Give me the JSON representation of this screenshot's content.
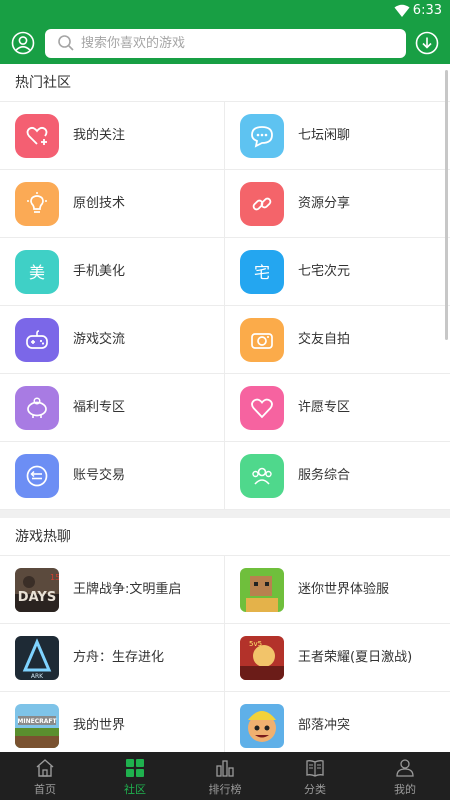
{
  "status_bar": {
    "time": "6:33",
    "wifi_icon": "wifi-icon"
  },
  "top_bar": {
    "avatar_icon": "user-avatar-icon",
    "search": {
      "placeholder": "搜索你喜欢的游戏",
      "value": "",
      "icon": "search-icon"
    },
    "download_icon": "download-icon",
    "background": "#189f44"
  },
  "hot_communities": {
    "title": "热门社区",
    "items": [
      {
        "label": "我的关注",
        "icon": "heart-plus-icon",
        "color": "#f45f72"
      },
      {
        "label": "七坛闲聊",
        "icon": "chat-bubble-icon",
        "color": "#5ec3f1"
      },
      {
        "label": "原创技术",
        "icon": "lightbulb-icon",
        "color": "#fbaa55"
      },
      {
        "label": "资源分享",
        "icon": "link-icon",
        "color": "#f4646a"
      },
      {
        "label": "手机美化",
        "icon": "beautify-icon",
        "color": "#3fd0c6"
      },
      {
        "label": "七宅次元",
        "icon": "house-char-icon",
        "color": "#24a6f0"
      },
      {
        "label": "游戏交流",
        "icon": "gamepad-icon",
        "color": "#7b67e8"
      },
      {
        "label": "交友自拍",
        "icon": "camera-icon",
        "color": "#fbab4a"
      },
      {
        "label": "福利专区",
        "icon": "piggy-bank-icon",
        "color": "#a87be3"
      },
      {
        "label": "许愿专区",
        "icon": "heart-icon",
        "color": "#f663a0"
      },
      {
        "label": "账号交易",
        "icon": "exchange-icon",
        "color": "#6c8ef4"
      },
      {
        "label": "服务综合",
        "icon": "users-icon",
        "color": "#4fd88c"
      }
    ]
  },
  "hot_games": {
    "title": "游戏热聊",
    "items": [
      {
        "label": "王牌战争:文明重启",
        "thumb": "game-thumb-wangpai"
      },
      {
        "label": "迷你世界体验服",
        "thumb": "game-thumb-mini-world"
      },
      {
        "label": "方舟：生存进化",
        "thumb": "game-thumb-ark"
      },
      {
        "label": "王者荣耀(夏日激战)",
        "thumb": "game-thumb-honor-of-kings"
      },
      {
        "label": "我的世界",
        "thumb": "game-thumb-minecraft"
      },
      {
        "label": "部落冲突",
        "thumb": "game-thumb-clash-of-clans"
      }
    ]
  },
  "bottom_nav": {
    "active_color": "#1fb14e",
    "tabs": [
      {
        "label": "首页",
        "icon": "home-icon",
        "active": false
      },
      {
        "label": "社区",
        "icon": "grid-icon",
        "active": true
      },
      {
        "label": "排行榜",
        "icon": "ranking-icon",
        "active": false
      },
      {
        "label": "分类",
        "icon": "book-icon",
        "active": false
      },
      {
        "label": "我的",
        "icon": "person-icon",
        "active": false
      }
    ]
  }
}
